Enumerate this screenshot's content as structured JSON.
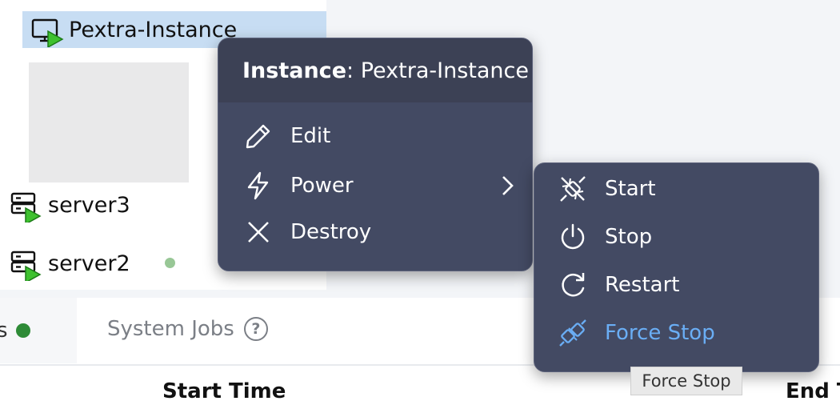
{
  "tree": {
    "items": [
      {
        "label": "Pextra-Instance",
        "icon": "monitor-play-icon",
        "selected": true
      },
      {
        "label": "server3",
        "icon": "server-play-icon"
      },
      {
        "label": "server2",
        "icon": "server-play-icon"
      }
    ]
  },
  "tabs": {
    "prev_tab_fragment": "s",
    "system_jobs_label": "System Jobs",
    "help_glyph": "?"
  },
  "table": {
    "columns": [
      "Start Time",
      "End T"
    ]
  },
  "context_menu": {
    "header_prefix": "Instance",
    "header_sep": ":",
    "header_name": "Pextra-Instance",
    "items": [
      {
        "label": "Edit",
        "icon": "pencil-icon"
      },
      {
        "label": "Power",
        "icon": "lightning-icon",
        "submenu": true
      },
      {
        "label": "Destroy",
        "icon": "x-icon"
      }
    ]
  },
  "power_submenu": {
    "items": [
      {
        "label": "Start",
        "icon": "plug-connected-icon"
      },
      {
        "label": "Stop",
        "icon": "power-icon"
      },
      {
        "label": "Restart",
        "icon": "restart-icon"
      },
      {
        "label": "Force Stop",
        "icon": "plug-disconnected-icon",
        "active": true
      }
    ]
  },
  "tooltip": {
    "text": "Force Stop"
  },
  "colors": {
    "menu_bg": "#434a63",
    "menu_header_bg": "#3c4155",
    "active_text": "#6aaef5",
    "selection": "#c7ddf3",
    "status_green": "#2e8b37",
    "status_light_green": "#98c796"
  }
}
